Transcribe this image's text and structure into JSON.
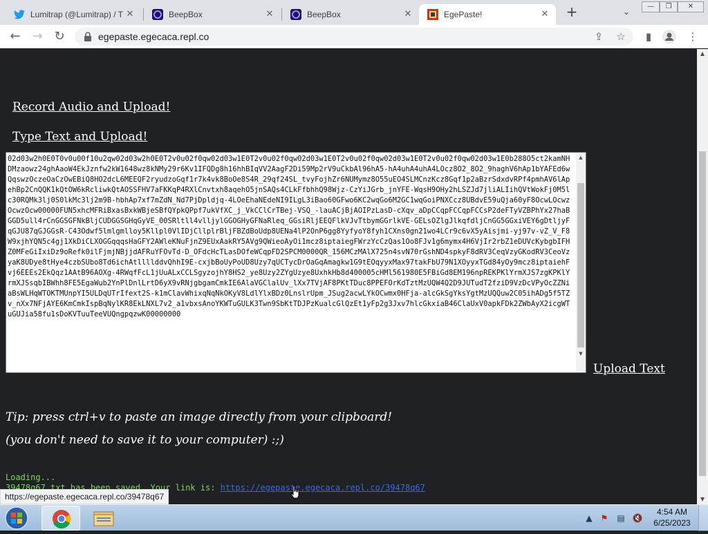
{
  "browser": {
    "tabs": [
      {
        "title": "Lumitrap (@Lumitrap) / T",
        "icon": "twitter-icon"
      },
      {
        "title": "BeepBox",
        "icon": "beepbox-icon"
      },
      {
        "title": "BeepBox",
        "icon": "beepbox-icon"
      },
      {
        "title": "EgePaste!",
        "icon": "egepaste-icon"
      }
    ],
    "active_tab": 3,
    "url": "egepaste.egecaca.repl.co"
  },
  "page": {
    "record_link": "Record Audio and Upload!",
    "type_link": "Type Text and Upload!",
    "textarea_value": "02d03w2h0E0T0v0u00f10u2qw02d03w2h0E0T2v0u02f0qw02d03w1E0T2v0u02f0qw02d03w1E0T2v0u02f0qw02d03w1E0T2v0u02f0qw02d03w1E0b288O5ct2kamNHDMzaowz24ghAaoW4EkJznfw2kW1648wz8kNMy29r6Kv1IFQDg8h16hhBIqVV2AagF2Di59Mp2rV9uCkbAl96hA5-hA4uhA4uhA4LOcz8O2_8O2_9haghV6hAp1bYAFEd6wQqswzOczeOaCzOwEBiQ8HO2dcL6MEEQF2ryudzoGqf1r7k4vk8BoOe8S4R_29qf24SL_tvyFojhZr6NUMymz8O55uEO4SLMCnzKcz8Gqf1p2aBzrSdxdvRPf4pmhAV6lApehBp2CnQQK1kQtOW6kRcliwkQtAOSSFHV7aFKKqP4RXlCnvtxh8aqehO5jnSAQs4CLkFfbhhQ98Wjz-CzYiJGrb_jnYFE-WqsH9OHy2hLSZJd7jliALIihQVtWokFj0M5lc30RQMk3lj0S0lkMc3lj2m9B-hbhAp7xf7mZdN_Nd7PjDpldjq-4LOeEhaNEdeNI9ILgL3iBao60GFwo6KC2wqGo6M2GC1wqGoiPNXCcz8UBdvE59uQja60yF8OcwLOcwzOcwzOcw00000FUN5xhcMFRiBxasBxkWBjeSBfQYpkQPpf7ukVfXC_j_VkCClCrTBej-VSQ_-lauACjBjAOIPzLasD-cXqv_aDpCCqpFCCqpFCCsP2deFTyVZBPhYx27haBGGD5ull4rCnGGSGFNkBljCUDGGSGHqGyVE_00SRltll4vlljylGGOGHyGFNaRleq_GGsiRljEEQFlkVJvTtbymGGrlkVE-GELsOZlgJlkqfdljCnGG5GGxiVEY6gDtljyFqGJU87qGJGGsR-C43Odwf5lmlgmlloy5Kllpl0VlIDjCllplrBljFBZdBoUdp8UENa4lP2OnP6gg8YyfyoY8fyh1CXns0gn21wo4LCr9c6vX5yAisjmi-yj97v-vZ_V_F8W9xjhYQN5c4gj1XkDiCLXOGGqqqsHaGFY2AWleKNuFjnZ9EUxAakRY5AVg9QWieoAyOi1mcz8iptaiegFWrzYcCzQas1Oo8FJv1g6mymx4H6VjIr2rbZ1eDUVcKybgbIFHZ0MFeGiIxiDz9oRefk0ilFjmjNBjjdAFRuYFOvTd-D_OFdcHcTLasDOfeWCqpFD2SPCM0000QR_156MCzMAlX725n4svN70rGshND4spkyF8dRV3CeqVzyGKodRV3CeoVzyaK8UDye8tHye4czbSUbo8Td6ichAtllllddvQhhI9E-cxjbBoUyPoUD8Uzy7qUCTycDrOaGqAmagkw1G9tEOqyyxMax97takFbU79N1XOyyxTGd84yOy9mcz8iptaiehFvj6EEEs2EkQqz1AAtB96AOXg-4RWqfFcL1jUuALxCCLSgyzojhY8HS2_ye8Uzy2ZYgUzye8UxhkHb8d400005cHMl561980E5FBiGd8EM196npREKPKlYrmXJS7zgKPKlYrmXJSsqbIBWhh8FE5EgaWub2YnPlDnlLrtD6yX9vRNjgbgamCmkIE6AlaVGClalUv_lXx7TVjAF8PKtTDuc8PPEFOrKdTztMzUQW4Q2D9JUTudT2fziD9VzDcVPyOcZZNiaBsWLHqWTOKTMUnpYI5ULDqUTrIfext2S-k1mClavWhixqNqNkOKyV8LdlYlxBDz0LnslrUpm_JSug2acwLYkOCwmx0HFja-alcGkSgYksYgtMzUQQuw2C05ihADg5f5TZv_nXx7NFjAYE6KmCmkIspBqNylKR8EkLNXL7v2_a1vbxsAnoYKWTuGULK3Twn9SbKtTDJPzKualcGlQzEt1yFp2g3Jxv7hlcGkxiaB46ClaUxV0apkFDk2ZWbAyX2icgWTuGUJia58fu1sDoKVTuuTeeVUQngpqzwK00000000",
    "upload_text_link": "Upload Text",
    "tip_line1": "Tip: press ctrl+v to paste an image directly from your clipboard!",
    "tip_line2": "(you don't need to save it to your computer) :;)",
    "loading": "Loading...",
    "saved_prefix": "39478q67.txt has been saved. Your link is:",
    "saved_link": "https://egepaste.egecaca.repl.co/39478q67"
  },
  "status_tooltip": "https://egepaste.egecaca.repl.co/39478q67",
  "taskbar": {
    "clock_time": "4:54 AM",
    "clock_date": "6/25/2023",
    "apps": [
      "chrome-icon",
      "file-explorer-icon"
    ]
  },
  "colors": {
    "page_bg": "#202124",
    "loading_text": "#7fd35c",
    "link_blue": "#3b63ff"
  }
}
